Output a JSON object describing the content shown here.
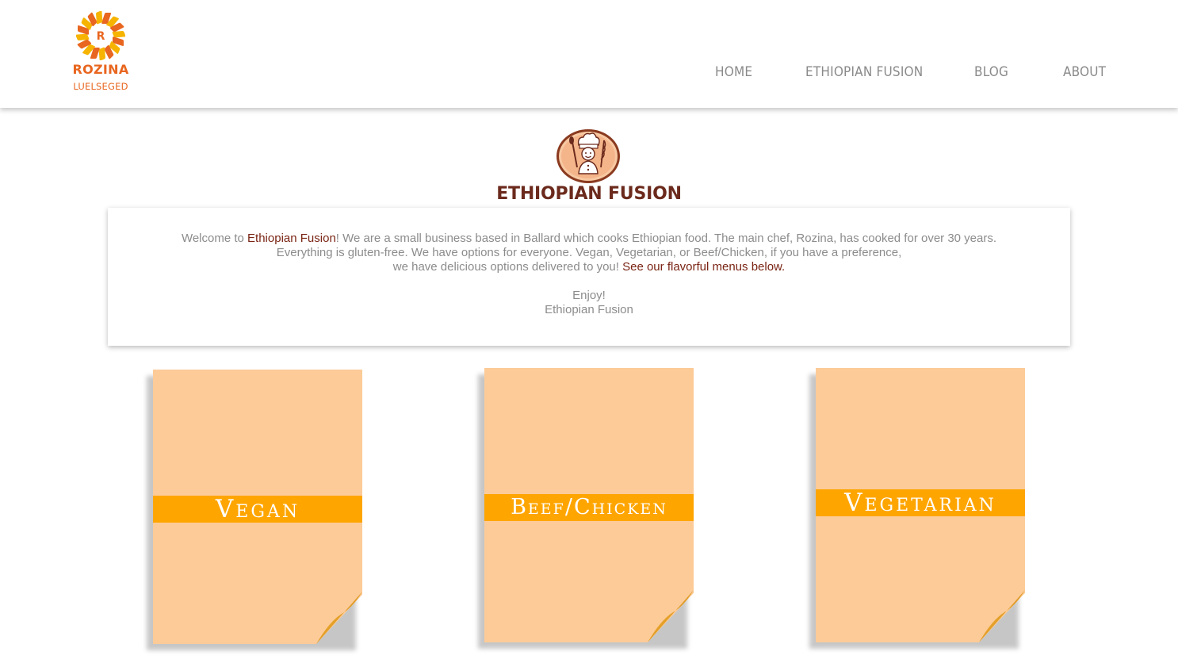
{
  "brand": {
    "name": "ROZINA",
    "subname": "LUELSEGED",
    "mark_letter": "R",
    "colors": {
      "primary": "#e8661f",
      "accent": "#f6b400"
    }
  },
  "nav": [
    {
      "label": "HOME"
    },
    {
      "label": "ETHIOPIAN FUSION"
    },
    {
      "label": "BLOG"
    },
    {
      "label": "ABOUT"
    }
  ],
  "section": {
    "title": "ETHIOPIAN FUSION",
    "badge_icon": "chef-icon",
    "title_color": "#6b2a1c"
  },
  "welcome": {
    "p1_before": "Welcome to ",
    "p1_highlight": "Ethiopian Fusion",
    "p1_after": "! We are a small business based in Ballard which cooks Ethiopian food. The main chef, Rozina, has cooked for over 30 years.",
    "p2": "Everything is gluten-free.  We have options for everyone. Vegan, Vegetarian, or Beef/Chicken, if you have a preference,",
    "p3_before": "we have delicious options delivered to you! ",
    "p3_link": "See our flavorful menus below.",
    "signoff_1": "Enjoy!",
    "signoff_2": "Ethiopian Fusion"
  },
  "menus": [
    {
      "label": "Vegan"
    },
    {
      "label": "Beef/Chicken"
    },
    {
      "label": "Vegetarian"
    }
  ],
  "colors": {
    "paper": "#fccb98",
    "band": "#ffa500",
    "nav_text": "#8a8a8a",
    "body_text": "#8c8c8c",
    "highlight": "#7a2414"
  }
}
